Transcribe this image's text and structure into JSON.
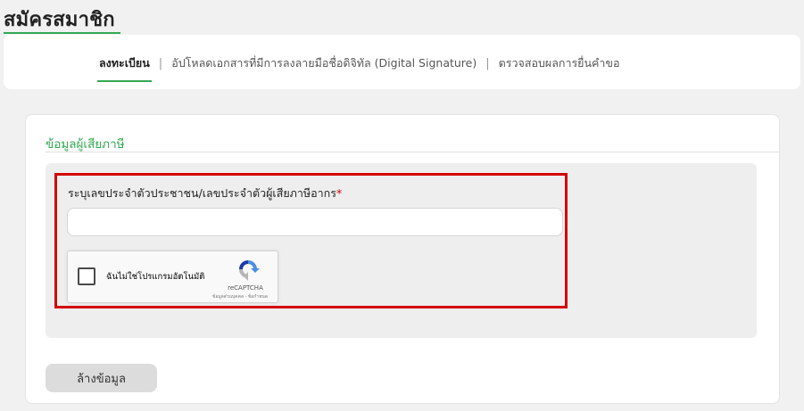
{
  "page": {
    "title": "สมัครสมาชิก"
  },
  "steps": [
    {
      "label": "ลงทะเบียน",
      "active": true
    },
    {
      "label": "อัปโหลดเอกสารที่มีการลงลายมือชื่อดิจิทัล (Digital Signature)",
      "active": false
    },
    {
      "label": "ตรวจสอบผลการยื่นคำขอ",
      "active": false
    }
  ],
  "steps_separator": "|",
  "section": {
    "title": "ข้อมูลผู้เสียภาษี"
  },
  "form": {
    "id_label": "ระบุเลขประจำตัวประชาชน/เลขประจำตัวผู้เสียภาษีอากร",
    "required_mark": "*",
    "id_value": "",
    "id_placeholder": ""
  },
  "recaptcha": {
    "label": "ฉันไม่ใช่โปรแกรมอัตโนมัติ",
    "brand": "reCAPTCHA",
    "terms": "ข้อมูลส่วนบุคคล - ข้อกำหนด",
    "logo_icon": "recaptcha-logo"
  },
  "actions": {
    "clear_label": "ล้างข้อมูล"
  },
  "colors": {
    "accent_green": "#34a853",
    "highlight_red": "#d40000",
    "panel_gray": "#eeeeee"
  }
}
